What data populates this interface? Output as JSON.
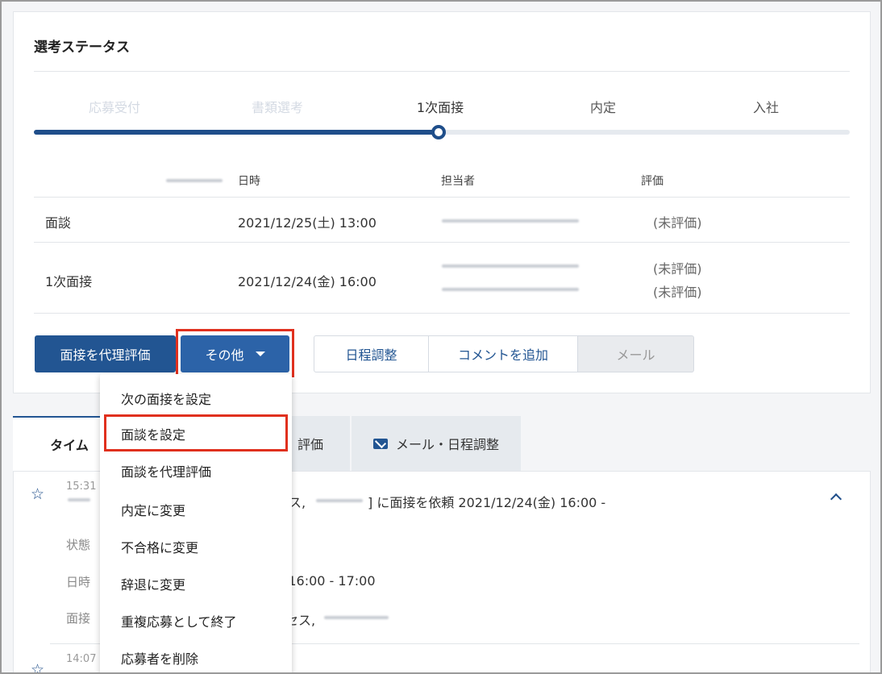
{
  "status_card": {
    "title": "選考ステータス",
    "steps": [
      {
        "label": "応募受付",
        "state": "done"
      },
      {
        "label": "書類選考",
        "state": "done"
      },
      {
        "label": "1次面接",
        "state": "current"
      },
      {
        "label": "内定",
        "state": "upcoming"
      },
      {
        "label": "入社",
        "state": "upcoming"
      }
    ],
    "progress_color": "#1f4e8a",
    "table_headers": {
      "datetime": "日時",
      "owner": "担当者",
      "rating": "評価"
    },
    "rows": [
      {
        "name": "面談",
        "datetime": "2021/12/25(土) 13:00",
        "ratings": [
          "(未評価)"
        ]
      },
      {
        "name": "1次面接",
        "datetime": "2021/12/24(金) 16:00",
        "ratings": [
          "(未評価)",
          "(未評価)"
        ]
      }
    ],
    "buttons": {
      "proxy_eval": "面接を代理評価",
      "more": "その他",
      "schedule": "日程調整",
      "add_comment": "コメントを追加",
      "mail": "メール"
    }
  },
  "dropdown_menu": {
    "items": [
      "次の面接を設定",
      "面談を設定",
      "面談を代理評価",
      "内定に変更",
      "不合格に変更",
      "辞退に変更",
      "重複応募として終了",
      "応募者を削除"
    ],
    "highlighted_index": 1
  },
  "tabs": {
    "timeline": "タイム",
    "evaluation": "評価",
    "mail_schedule": "メール・日程調整"
  },
  "timeline": {
    "entry1_time": "15:31",
    "entry1_text_prefix": "ス,",
    "entry1_text": "] に面接を依頼 2021/12/24(金) 16:00 -",
    "label_status": "状態",
    "label_datetime": "日時",
    "label_interviewer": "面接",
    "datetime_value": ") 16:00 - 17:00",
    "interviewer_value": "セス,",
    "entry2_time": "14:07"
  },
  "colors": {
    "brand_blue": "#225592",
    "highlight_red": "#e0301e"
  }
}
